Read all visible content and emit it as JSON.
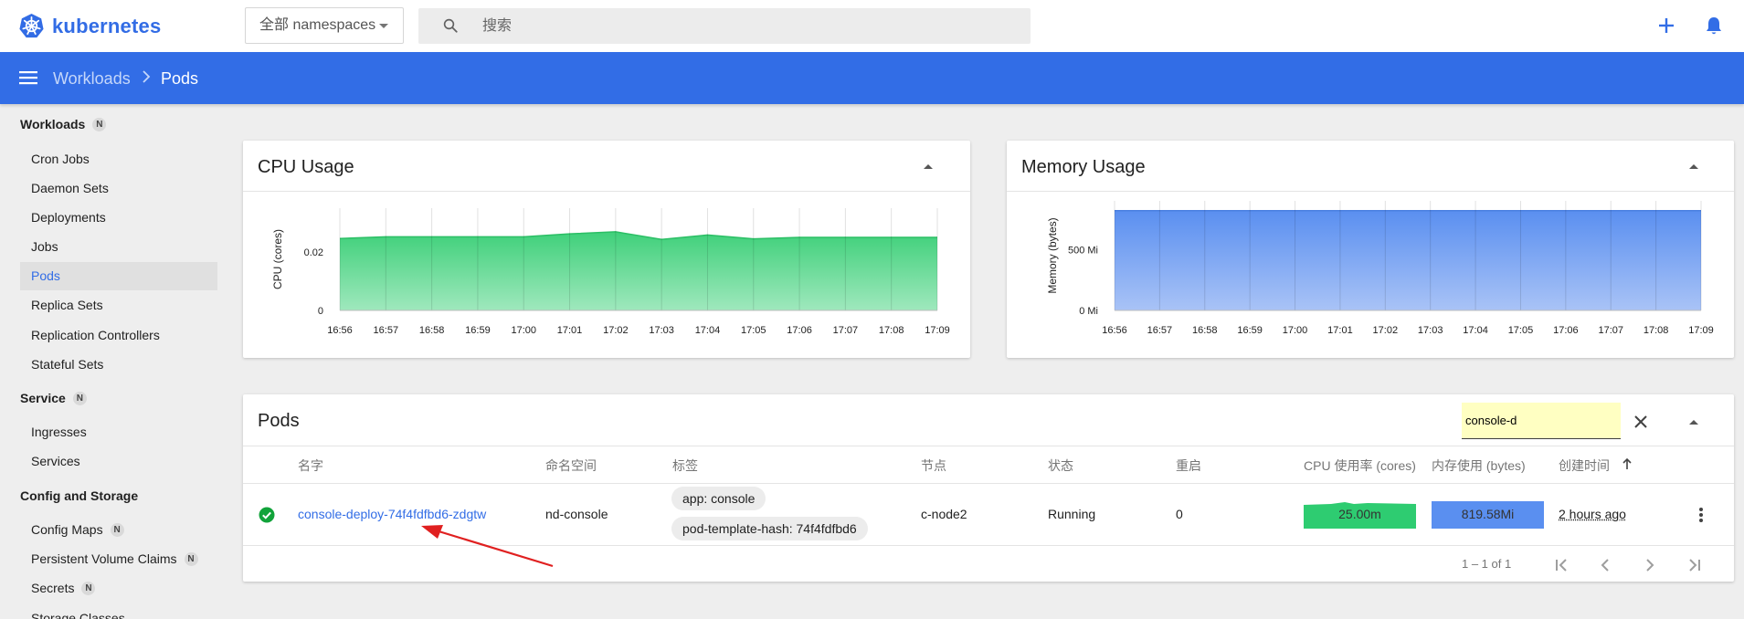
{
  "app": {
    "name": "kubernetes",
    "brand_color": "#326ce5"
  },
  "topbar": {
    "namespace_select": "全部 namespaces",
    "search_placeholder": "搜索",
    "icons": [
      "search-icon",
      "plus-icon",
      "bell-icon"
    ]
  },
  "breadcrumb": {
    "parent": "Workloads",
    "current": "Pods"
  },
  "sidebar": {
    "sections": [
      {
        "title": "Workloads",
        "badge": "N",
        "items": [
          "Cron Jobs",
          "Daemon Sets",
          "Deployments",
          "Jobs",
          "Pods",
          "Replica Sets",
          "Replication Controllers",
          "Stateful Sets"
        ]
      },
      {
        "title": "Service",
        "badge": "N",
        "items": [
          "Ingresses",
          "Services"
        ]
      },
      {
        "title": "Config and Storage",
        "items": [
          "Config Maps",
          "Persistent Volume Claims",
          "Secrets",
          "Storage Classes"
        ]
      }
    ],
    "active_item": "Pods",
    "item_badges": {
      "Config Maps": "N",
      "Persistent Volume Claims": "N",
      "Secrets": "N"
    }
  },
  "cards": {
    "cpu_title": "CPU Usage",
    "memory_title": "Memory Usage",
    "pods_title": "Pods"
  },
  "chart_data": [
    {
      "type": "area",
      "ylabel": "CPU (cores)",
      "y_ticks": [
        "0",
        "0.02"
      ],
      "ylim": [
        0,
        0.035
      ],
      "x": [
        "16:56",
        "16:57",
        "16:58",
        "16:59",
        "17:00",
        "17:01",
        "17:02",
        "17:03",
        "17:04",
        "17:05",
        "17:06",
        "17:07",
        "17:08",
        "17:09"
      ],
      "values": [
        0.0246,
        0.0252,
        0.0252,
        0.0252,
        0.0252,
        0.0262,
        0.0269,
        0.0243,
        0.0258,
        0.0245,
        0.025,
        0.025,
        0.025,
        0.025
      ],
      "color": "#2ecc71",
      "grid": true
    },
    {
      "type": "area",
      "ylabel": "Memory (bytes)",
      "y_ticks": [
        "0 Mi",
        "500 Mi"
      ],
      "ylim": [
        0,
        900
      ],
      "x": [
        "16:56",
        "16:57",
        "16:58",
        "16:59",
        "17:00",
        "17:01",
        "17:02",
        "17:03",
        "17:04",
        "17:05",
        "17:06",
        "17:07",
        "17:08",
        "17:09"
      ],
      "values": [
        819.58,
        819.58,
        819.58,
        819.58,
        819.58,
        819.58,
        819.58,
        819.58,
        819.58,
        819.58,
        819.58,
        819.58,
        819.58,
        819.58
      ],
      "color": "#5a8ff0",
      "grid": true
    }
  ],
  "pods_table": {
    "filter_value": "console-d",
    "columns": [
      "名字",
      "命名空间",
      "标签",
      "节点",
      "状态",
      "重启",
      "CPU 使用率 (cores)",
      "内存使用 (bytes)",
      "创建时间"
    ],
    "rows": [
      {
        "name": "console-deploy-74f4fdfbd6-zdgtw",
        "namespace": "nd-console",
        "labels": [
          "app: console",
          "pod-template-hash: 74f4fdfbd6"
        ],
        "node": "c-node2",
        "status": "Running",
        "restarts": "0",
        "cpu": "25.00m",
        "memory": "819.58Mi",
        "created": "2 hours ago"
      }
    ],
    "pagination": "1 – 1 of 1"
  }
}
